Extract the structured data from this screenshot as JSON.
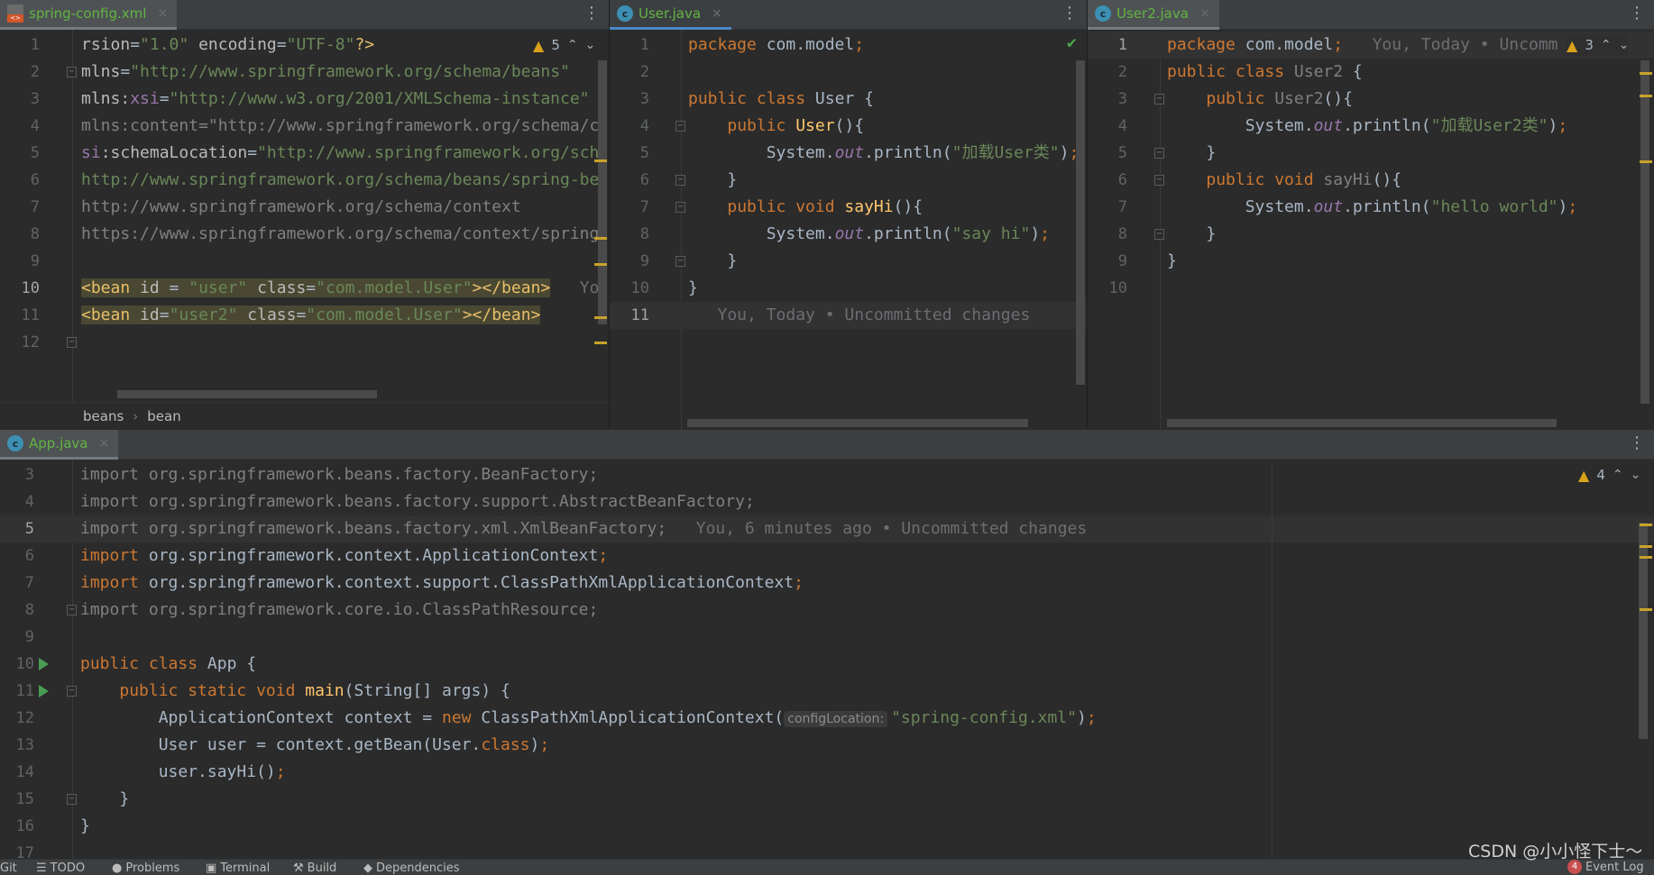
{
  "colors": {
    "keyword": "#cc7832",
    "string": "#6a8759",
    "text": "#a9b7c6",
    "field": "#9876aa",
    "method": "#ffc66d",
    "unused": "#808080",
    "tag": "#e8bf6a",
    "accent": "#4a88c7",
    "warning": "#d9a21b",
    "run": "#499c54"
  },
  "panes": [
    {
      "id": "xml",
      "tab": {
        "label": "spring-config.xml",
        "icon": "xml-file-icon",
        "close": "×"
      },
      "warnings": "5",
      "lines": [
        {
          "n": "1",
          "tokens": [
            [
              "a",
              "rsion"
            ],
            [
              "t",
              "="
            ],
            [
              "s",
              "\"1.0\""
            ],
            [
              "t",
              " "
            ],
            [
              "a",
              "encoding"
            ],
            [
              "t",
              "="
            ],
            [
              "s",
              "\"UTF-8\""
            ],
            [
              "g",
              "?>"
            ]
          ]
        },
        {
          "n": "2",
          "fold": "open",
          "tokens": [
            [
              "a",
              "mlns"
            ],
            [
              "t",
              "="
            ],
            [
              "s",
              "\"http://www.springframework.org/schema/beans\""
            ]
          ]
        },
        {
          "n": "3",
          "tokens": [
            [
              "a",
              "mlns:"
            ],
            [
              "p",
              "xsi"
            ],
            [
              "t",
              "="
            ],
            [
              "s",
              "\"http://www.w3.org/2001/XMLSchema-instance\""
            ]
          ]
        },
        {
          "n": "4",
          "tokens": [
            [
              "u",
              "mlns:content=\"http://www.springframework.org/schema/c"
            ]
          ]
        },
        {
          "n": "5",
          "tokens": [
            [
              "p",
              "si"
            ],
            [
              "a",
              ":schemaLocation"
            ],
            [
              "t",
              "="
            ],
            [
              "s",
              "\"http://www.springframework.org/sch"
            ]
          ]
        },
        {
          "n": "6",
          "tokens": [
            [
              "s",
              "http://www.springframework.org/schema/beans/spring-be"
            ]
          ]
        },
        {
          "n": "7",
          "tokens": [
            [
              "u",
              "http://www.springframework.org/schema/context"
            ]
          ]
        },
        {
          "n": "8",
          "tokens": [
            [
              "u",
              "https://www.springframework.org/schema/context/spring"
            ]
          ]
        },
        {
          "n": "9",
          "tokens": []
        },
        {
          "n": "10",
          "curn": true,
          "hl": true,
          "tokens": [
            [
              "g",
              "<bean "
            ],
            [
              "a",
              "id"
            ],
            [
              "t",
              " = "
            ],
            [
              "s",
              "\"user\""
            ],
            [
              "t",
              " "
            ],
            [
              "a",
              "class"
            ],
            [
              "t",
              "="
            ],
            [
              "s",
              "\"com.model.User\""
            ],
            [
              "g",
              "></bean>"
            ]
          ],
          "blame": "   Yo"
        },
        {
          "n": "11",
          "hl": true,
          "tokens": [
            [
              "g",
              "<bean "
            ],
            [
              "a",
              "id"
            ],
            [
              "t",
              "="
            ],
            [
              "s",
              "\"user2\""
            ],
            [
              "t",
              " "
            ],
            [
              "a",
              "class"
            ],
            [
              "t",
              "="
            ],
            [
              "s",
              "\"com.model.User\""
            ],
            [
              "g",
              "></bean>"
            ]
          ]
        },
        {
          "n": "12",
          "fold": "close",
          "tokens": []
        }
      ],
      "breadcrumb": [
        "beans",
        "bean"
      ]
    },
    {
      "id": "user",
      "tab": {
        "label": "User.java",
        "icon": "java-class-icon",
        "close": "×"
      },
      "status": "check-icon",
      "lines": [
        {
          "n": "1",
          "tokens": [
            [
              "k",
              "package"
            ],
            [
              "t",
              " com.model"
            ],
            [
              "k",
              ";"
            ]
          ]
        },
        {
          "n": "2",
          "tokens": []
        },
        {
          "n": "3",
          "tokens": [
            [
              "k",
              "public class "
            ],
            [
              "t",
              "User {"
            ]
          ]
        },
        {
          "n": "4",
          "fold": "open",
          "tokens": [
            [
              "t",
              "    "
            ],
            [
              "k",
              "public "
            ],
            [
              "m",
              "User"
            ],
            [
              "t",
              "(){"
            ]
          ]
        },
        {
          "n": "5",
          "tokens": [
            [
              "t",
              "        System."
            ],
            [
              "f",
              "out"
            ],
            [
              "t",
              ".println("
            ],
            [
              "s",
              "\"加载User类\""
            ],
            [
              "t",
              ")"
            ],
            [
              "k",
              ";"
            ]
          ]
        },
        {
          "n": "6",
          "fold": "close",
          "tokens": [
            [
              "t",
              "    }"
            ]
          ]
        },
        {
          "n": "7",
          "fold": "open",
          "tokens": [
            [
              "t",
              "    "
            ],
            [
              "k",
              "public void "
            ],
            [
              "m",
              "sayHi"
            ],
            [
              "t",
              "(){"
            ]
          ]
        },
        {
          "n": "8",
          "tokens": [
            [
              "t",
              "        System."
            ],
            [
              "f",
              "out"
            ],
            [
              "t",
              ".println("
            ],
            [
              "s",
              "\"say hi\""
            ],
            [
              "t",
              ")"
            ],
            [
              "k",
              ";"
            ]
          ]
        },
        {
          "n": "9",
          "fold": "close",
          "tokens": [
            [
              "t",
              "    }"
            ]
          ]
        },
        {
          "n": "10",
          "tokens": [
            [
              "t",
              "}"
            ]
          ]
        },
        {
          "n": "11",
          "cur": true,
          "tokens": [],
          "blame": "   You, Today • Uncommitted changes"
        }
      ]
    },
    {
      "id": "user2",
      "tab": {
        "label": "User2.java",
        "icon": "java-class-icon",
        "close": "×"
      },
      "warnings": "3",
      "lines": [
        {
          "n": "1",
          "cur": true,
          "tokens": [
            [
              "k",
              "package"
            ],
            [
              "t",
              " com.model"
            ],
            [
              "k",
              ";"
            ]
          ],
          "blame": "   You, Today • Uncomm"
        },
        {
          "n": "2",
          "tokens": [
            [
              "k",
              "public class "
            ],
            [
              "u",
              "User2"
            ],
            [
              "t",
              " {"
            ]
          ]
        },
        {
          "n": "3",
          "fold": "open",
          "tokens": [
            [
              "t",
              "    "
            ],
            [
              "k",
              "public "
            ],
            [
              "u",
              "User2"
            ],
            [
              "t",
              "(){"
            ]
          ]
        },
        {
          "n": "4",
          "tokens": [
            [
              "t",
              "        System."
            ],
            [
              "f",
              "out"
            ],
            [
              "t",
              ".println("
            ],
            [
              "s",
              "\"加载User2类\""
            ],
            [
              "t",
              ")"
            ],
            [
              "k",
              ";"
            ]
          ]
        },
        {
          "n": "5",
          "fold": "close",
          "tokens": [
            [
              "t",
              "    }"
            ]
          ]
        },
        {
          "n": "6",
          "fold": "open",
          "tokens": [
            [
              "t",
              "    "
            ],
            [
              "k",
              "public void "
            ],
            [
              "u",
              "sayHi"
            ],
            [
              "t",
              "(){"
            ]
          ]
        },
        {
          "n": "7",
          "tokens": [
            [
              "t",
              "        System."
            ],
            [
              "f",
              "out"
            ],
            [
              "t",
              ".println("
            ],
            [
              "s",
              "\"hello world\""
            ],
            [
              "t",
              ")"
            ],
            [
              "k",
              ";"
            ]
          ]
        },
        {
          "n": "8",
          "fold": "close",
          "tokens": [
            [
              "t",
              "    }"
            ]
          ]
        },
        {
          "n": "9",
          "tokens": [
            [
              "t",
              "}"
            ]
          ]
        },
        {
          "n": "10",
          "tokens": []
        }
      ]
    },
    {
      "id": "app",
      "tab": {
        "label": "App.java",
        "icon": "java-runnable-class-icon",
        "close": "×"
      },
      "warnings": "4",
      "lines": [
        {
          "n": "3",
          "tokens": [
            [
              "u",
              "import org.springframework.beans.factory.BeanFactory;"
            ]
          ]
        },
        {
          "n": "4",
          "tokens": [
            [
              "u",
              "import org.springframework.beans.factory.support.AbstractBeanFactory;"
            ]
          ]
        },
        {
          "n": "5",
          "cur": true,
          "tokens": [
            [
              "u",
              "import org.springframework.beans.factory.xml.XmlBeanFactory;"
            ]
          ],
          "blame": "   You, 6 minutes ago • Uncommitted changes"
        },
        {
          "n": "6",
          "tokens": [
            [
              "k",
              "import "
            ],
            [
              "t",
              "org.springframework.context.ApplicationContext"
            ],
            [
              "k",
              ";"
            ]
          ]
        },
        {
          "n": "7",
          "tokens": [
            [
              "k",
              "import "
            ],
            [
              "t",
              "org.springframework.context.support.ClassPathXmlApplicationContext"
            ],
            [
              "k",
              ";"
            ]
          ]
        },
        {
          "n": "8",
          "fold": "close",
          "tokens": [
            [
              "u",
              "import org.springframework.core.io.ClassPathResource;"
            ]
          ]
        },
        {
          "n": "9",
          "tokens": []
        },
        {
          "n": "10",
          "run": true,
          "tokens": [
            [
              "k",
              "public class "
            ],
            [
              "t",
              "App {"
            ]
          ]
        },
        {
          "n": "11",
          "run": true,
          "fold": "open",
          "tokens": [
            [
              "t",
              "    "
            ],
            [
              "k",
              "public static void "
            ],
            [
              "m",
              "main"
            ],
            [
              "t",
              "(String[] args) {"
            ]
          ]
        },
        {
          "n": "12",
          "tokens": [
            [
              "t",
              "        ApplicationContext context = "
            ],
            [
              "k",
              "new "
            ],
            [
              "t",
              "ClassPathXmlApplicationContext("
            ],
            [
              "inlay",
              "configLocation:"
            ],
            [
              "s",
              "\"spring-config.xml\""
            ],
            [
              "t",
              ")"
            ],
            [
              "k",
              ";"
            ]
          ]
        },
        {
          "n": "13",
          "tokens": [
            [
              "t",
              "        User user = context.getBean(User."
            ],
            [
              "k",
              "class"
            ],
            [
              "t",
              ")"
            ],
            [
              "k",
              ";"
            ]
          ]
        },
        {
          "n": "14",
          "tokens": [
            [
              "t",
              "        user.sayHi()"
            ],
            [
              "k",
              ";"
            ]
          ]
        },
        {
          "n": "15",
          "fold": "close",
          "tokens": [
            [
              "t",
              "    }"
            ]
          ]
        },
        {
          "n": "16",
          "tokens": [
            [
              "t",
              "}"
            ]
          ]
        },
        {
          "n": "17",
          "tokens": []
        }
      ]
    }
  ],
  "statusbar": {
    "items": [
      "Git",
      "TODO",
      "Problems",
      "Terminal",
      "Build",
      "Dependencies"
    ],
    "event_log": "Event Log",
    "event_count": "4"
  },
  "watermark": "CSDN @小小怪下士～"
}
